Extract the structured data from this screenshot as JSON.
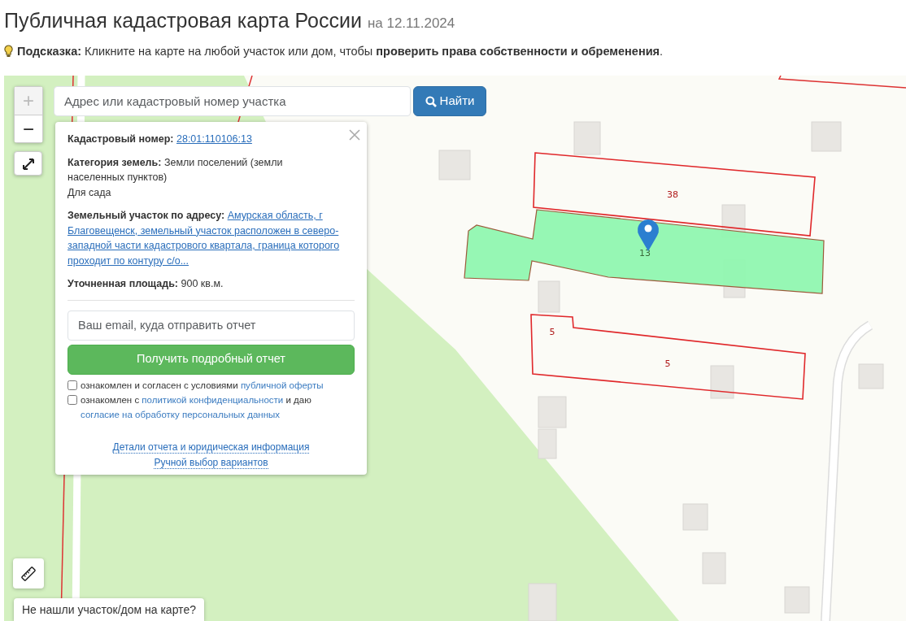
{
  "page": {
    "title": "Публичная кадастровая карта России",
    "date": "на 12.11.2024"
  },
  "hint": "**Подсказка:** Кликните на карте на любой участок или дом, чтобы **проверить права собственности и обременения**.",
  "search": {
    "placeholder": "Адрес или кадастровый номер участка",
    "button": "Найти"
  },
  "zoom_controls": [
    {
      "label": "+",
      "disabled": true
    },
    {
      "label": "−",
      "disabled": false
    }
  ],
  "popup": {
    "fields": [
      {
        "label": "Кадастровый номер:",
        "kind": "link",
        "value": "28:01:110106:13"
      },
      {
        "label": "Категория земель:",
        "kind": "text",
        "value": "Земли поселений (земли населенных пунктов)",
        "note": "Для сада"
      },
      {
        "label": "Земельный участок по адресу:",
        "kind": "link",
        "value": "Амурская область, г Благовещенск, земельный участок расположен в северо-западной части кадастрового квартала, граница которого проходит по контуру с/о..."
      },
      {
        "label": "Уточненная площадь:",
        "kind": "text",
        "value": "900 кв.м."
      }
    ],
    "email_placeholder": "Ваш email, куда отправить отчет",
    "submit": "Получить подробный отчет",
    "consents": [
      {
        "checked": false,
        "parts": [
          {
            "text": "ознакомлен и согласен с условиями",
            "link": false
          },
          {
            "text": "публичной оферты",
            "link": true
          }
        ]
      },
      {
        "checked": false,
        "parts": [
          {
            "text": "ознакомлен с",
            "link": false
          },
          {
            "text": "политикой конфиденциальности",
            "link": true
          },
          {
            "text": "и даю",
            "link": false
          },
          {
            "text": "согласие на обработку персональных данных",
            "link": true
          }
        ]
      }
    ],
    "footer_links": [
      "Детали отчета и юридическая информация",
      "Ручной выбор вариантов"
    ]
  },
  "parcels": [
    {
      "labels": [
        "38"
      ],
      "selected": false
    },
    {
      "labels": [
        "13"
      ],
      "selected": true
    },
    {
      "labels": [
        "5",
        "5"
      ],
      "selected": false
    }
  ],
  "not_found_button": "Не нашли участок/дом на карте?"
}
